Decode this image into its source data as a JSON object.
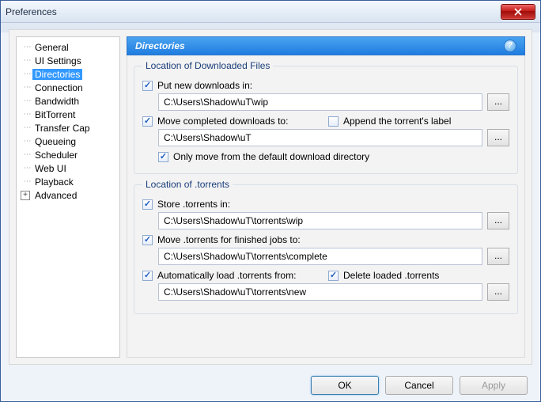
{
  "window": {
    "title": "Preferences"
  },
  "sidebar": {
    "items": [
      {
        "label": "General"
      },
      {
        "label": "UI Settings"
      },
      {
        "label": "Directories",
        "selected": true
      },
      {
        "label": "Connection"
      },
      {
        "label": "Bandwidth"
      },
      {
        "label": "BitTorrent"
      },
      {
        "label": "Transfer Cap"
      },
      {
        "label": "Queueing"
      },
      {
        "label": "Scheduler"
      },
      {
        "label": "Web UI"
      },
      {
        "label": "Playback"
      },
      {
        "label": "Advanced",
        "expandable": true
      }
    ]
  },
  "header": {
    "title": "Directories"
  },
  "groups": {
    "downloads": {
      "legend": "Location of Downloaded Files",
      "put_new": {
        "label": "Put new downloads in:",
        "checked": true,
        "path": "C:\\Users\\Shadow\\uT\\wip"
      },
      "move_completed": {
        "label": "Move completed downloads to:",
        "checked": true,
        "path": "C:\\Users\\Shadow\\uT"
      },
      "append_label": {
        "label": "Append the torrent's label",
        "checked": false
      },
      "only_move": {
        "label": "Only move from the default download directory",
        "checked": true
      }
    },
    "torrents": {
      "legend": "Location of .torrents",
      "store": {
        "label": "Store .torrents in:",
        "checked": true,
        "path": "C:\\Users\\Shadow\\uT\\torrents\\wip"
      },
      "move_finished": {
        "label": "Move .torrents for finished jobs to:",
        "checked": true,
        "path": "C:\\Users\\Shadow\\uT\\torrents\\complete"
      },
      "autoload": {
        "label": "Automatically load .torrents from:",
        "checked": true,
        "path": "C:\\Users\\Shadow\\uT\\torrents\\new"
      },
      "delete_loaded": {
        "label": "Delete loaded .torrents",
        "checked": true
      }
    }
  },
  "buttons": {
    "browse": "...",
    "ok": "OK",
    "cancel": "Cancel",
    "apply": "Apply"
  }
}
